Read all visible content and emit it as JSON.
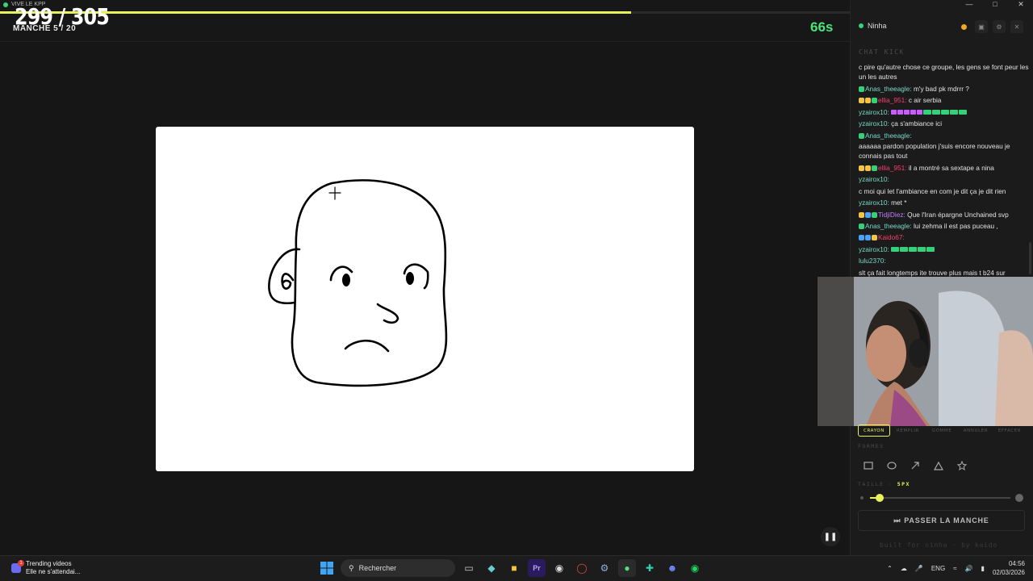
{
  "window": {
    "title": "VIVE LE KPP"
  },
  "header": {
    "score": "299 / 305",
    "round": "MANCHE 5 / 20",
    "timer": "66s",
    "progress_fraction": 0.743
  },
  "panel": {
    "user": "Ninha",
    "chat_title": "CHAT KICK",
    "messages": [
      {
        "user": "",
        "text": "c pire qu'autre chose ce groupe, les gens se font peur les un les autres",
        "wrap": true
      },
      {
        "user": "Anas_theeagle:",
        "text": "m'y bad pk mdrrr ?",
        "color": "cyan",
        "badges": [
          "green"
        ]
      },
      {
        "user": "ellia_951:",
        "text": "c air serbia",
        "color": "pink",
        "badges": [
          "gold",
          "gold",
          "green"
        ]
      },
      {
        "user": "yzairox10:",
        "text": "",
        "color": "cyan",
        "emotes": 10
      },
      {
        "user": "yzairox10:",
        "text": "ça s'ambiance ici",
        "color": "cyan"
      },
      {
        "user": "Anas_theeagle:",
        "text": "",
        "color": "cyan",
        "badges": [
          "green"
        ]
      },
      {
        "user": "",
        "text": "aaaaaa pardon population j'suis encore nouveau je connais pas tout",
        "wrap": true
      },
      {
        "user": "ellia_951:",
        "text": "il a montré sa sextape a nina",
        "color": "pink",
        "badges": [
          "gold",
          "gold",
          "green"
        ]
      },
      {
        "user": "yzairox10:",
        "text": "",
        "color": "cyan"
      },
      {
        "user": "",
        "text": "c moi qui let l'ambiance en com je dit ça je dit rien"
      },
      {
        "user": "yzairox10:",
        "text": "met *",
        "color": "cyan"
      },
      {
        "user": "TidjiDiez:",
        "text": "Que l'Iran épargne Unchained svp",
        "color": "purple",
        "badges": [
          "gold",
          "blue",
          "green"
        ]
      },
      {
        "user": "Anas_theeagle:",
        "text": "lui zehma il est pas puceau ,",
        "color": "cyan",
        "badges": [
          "green"
        ]
      },
      {
        "user": "Kaido67:",
        "text": "",
        "color": "pink",
        "badges": [
          "blue",
          "blue",
          "gold"
        ]
      },
      {
        "user": "yzairox10:",
        "text": "",
        "color": "cyan",
        "emotes": 5
      },
      {
        "user": "lulu2370:",
        "text": "",
        "color": "cyan"
      },
      {
        "user": "",
        "text": "slt ça fait longtemps ite trouve plus mais t b24 sur"
      }
    ],
    "tools": [
      "CRAYON",
      "REMPLIR",
      "GOMME",
      "ANNULER",
      "EFFACER"
    ],
    "forms_label": "FORMES",
    "shapes": [
      "rectangle-icon",
      "ellipse-icon",
      "arrow-icon",
      "triangle-icon",
      "star-icon"
    ],
    "size_label": "TAILLE ·",
    "size_value": "5PX",
    "size_fraction": 0.07,
    "skip_label": "PASSER LA MANCHE",
    "footer": "built for ninha · by kaido"
  },
  "taskbar": {
    "trend_title": "Trending videos",
    "trend_sub": "Elle ne s'attendai...",
    "search": "Rechercher",
    "lang": "ENG",
    "time": "04:56",
    "date": "02/03/2026"
  },
  "colors": {
    "accent": "#e8f05a",
    "timer": "#4ee37a"
  }
}
